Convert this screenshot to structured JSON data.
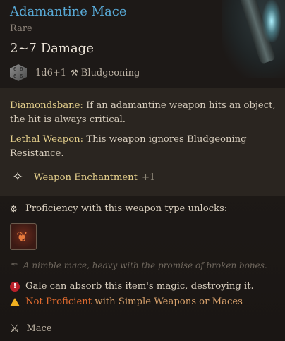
{
  "item": {
    "name": "Adamantine Mace",
    "rarity": "Rare",
    "damage": "2~7 Damage",
    "dice": "1d6+1",
    "die_faces": [
      "6",
      "6",
      "6",
      "6"
    ],
    "damage_type": "Bludgeoning"
  },
  "properties": [
    {
      "name": "Diamondsbane:",
      "text": "If an adamantine weapon hits an object, the hit is always critical."
    },
    {
      "name": "Lethal Weapon:",
      "text": "This weapon ignores Bludgeoning Resistance."
    }
  ],
  "enchantment": {
    "label": "Weapon Enchantment",
    "bonus": "+1"
  },
  "proficiency_unlock": "Proficiency with this weapon type unlocks:",
  "flavor": "A nimble mace, heavy with the promise of broken bones.",
  "absorb_note": "Gale can absorb this item's magic, destroying it.",
  "proficiency_warning": {
    "status": "Not Proficient",
    "detail": "with Simple Weapons or Maces"
  },
  "weapon_type": "Mace",
  "colors": {
    "name": "#58a9d6",
    "property_name": "#e4cf8c",
    "not_proficient": "#e06b2f",
    "warning_detail": "#d6a06b"
  },
  "icons": {
    "die": "d6-die-icon",
    "damage_type": "hammer-icon",
    "enchantment": "anvil-sparkle-icon",
    "unlock": "gear-icon",
    "action": "weapon-action-icon",
    "flavor": "feather-icon",
    "absorb": "exclamation-icon",
    "warning": "warning-triangle-icon",
    "type": "crossed-weapons-icon"
  }
}
